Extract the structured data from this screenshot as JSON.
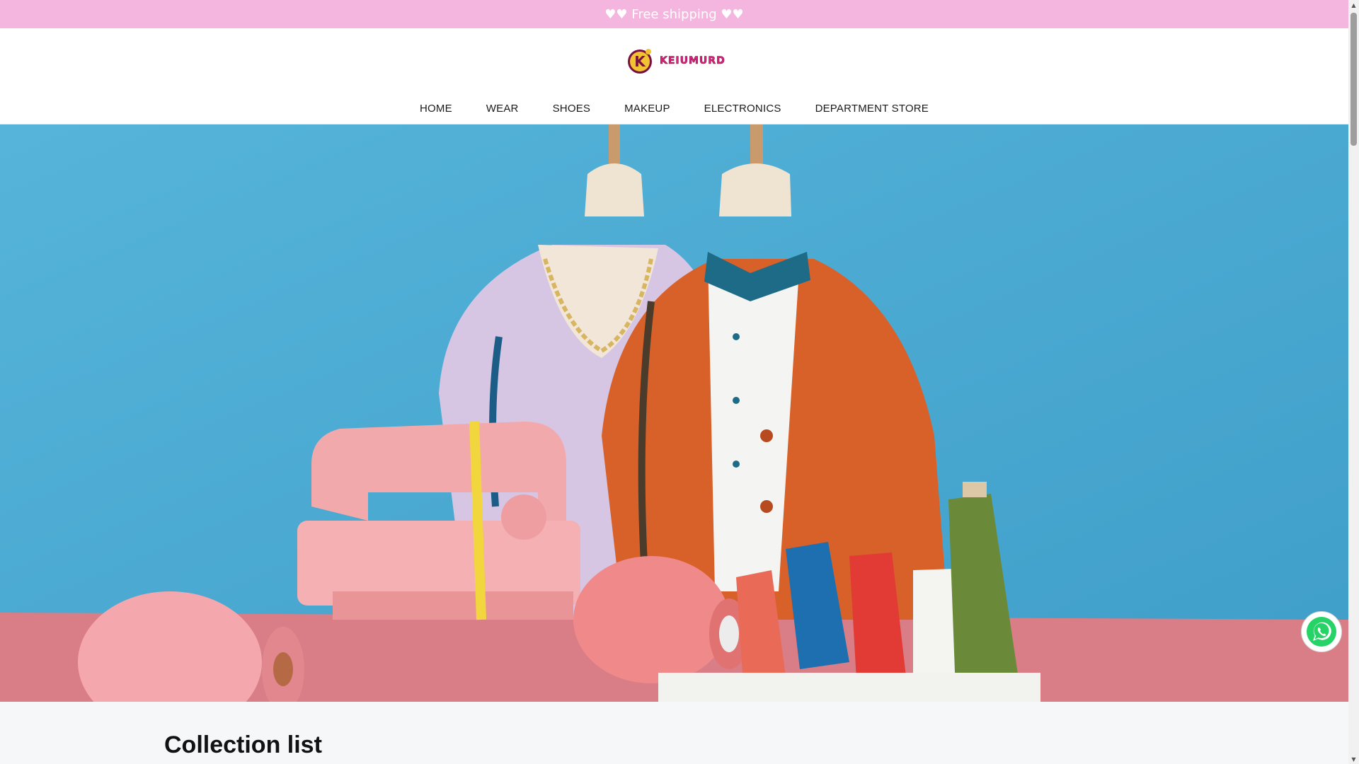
{
  "announcement": {
    "text": "♥♥ Free shipping ♥♥"
  },
  "header": {
    "logo": {
      "letter": "K",
      "name": "KEIUMURD"
    },
    "nav": [
      {
        "label": "HOME"
      },
      {
        "label": "WEAR"
      },
      {
        "label": "SHOES"
      },
      {
        "label": "MAKEUP"
      },
      {
        "label": "ELECTRONICS"
      },
      {
        "label": "DEPARTMENT STORE"
      }
    ]
  },
  "collection": {
    "title": "Collection list"
  },
  "colors": {
    "announcement_bg": "#f4b6df",
    "hero_sky": "#4faed4",
    "hero_floor": "#d97e86",
    "whatsapp_green": "#25d366",
    "logo_accent": "#e0237f"
  },
  "icons": {
    "whatsapp": "whatsapp-icon",
    "logo_mark": "k-logo-icon"
  }
}
